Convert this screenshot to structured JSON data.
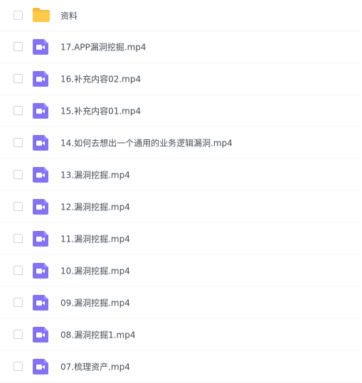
{
  "colors": {
    "folder": "#ffc94a",
    "folder_back": "#f8b93b",
    "video_icon": "#8373f0",
    "text": "#454d5a",
    "divider": "#f1f2f4",
    "checkbox_border": "#d0d4da"
  },
  "files": [
    {
      "name": "资料",
      "icon": "folder-icon"
    },
    {
      "name": "17.APP漏洞挖掘.mp4",
      "icon": "video-file-icon"
    },
    {
      "name": "16.补充内容02.mp4",
      "icon": "video-file-icon"
    },
    {
      "name": "15.补充内容01.mp4",
      "icon": "video-file-icon"
    },
    {
      "name": "14.如何去想出一个通用的业务逻辑漏洞.mp4",
      "icon": "video-file-icon"
    },
    {
      "name": "13.漏洞挖掘.mp4",
      "icon": "video-file-icon"
    },
    {
      "name": "12.漏洞挖掘.mp4",
      "icon": "video-file-icon"
    },
    {
      "name": "11.漏洞挖掘.mp4",
      "icon": "video-file-icon"
    },
    {
      "name": "10.漏洞挖掘.mp4",
      "icon": "video-file-icon"
    },
    {
      "name": "09.漏洞挖掘.mp4",
      "icon": "video-file-icon"
    },
    {
      "name": "08.漏洞挖掘1.mp4",
      "icon": "video-file-icon"
    },
    {
      "name": "07.梳理资产.mp4",
      "icon": "video-file-icon"
    }
  ]
}
